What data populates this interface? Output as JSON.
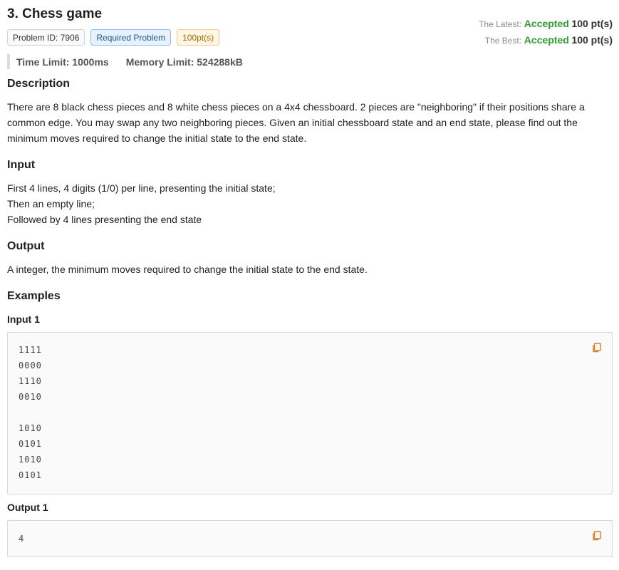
{
  "problem": {
    "title": "3.  Chess game",
    "id_tag": "Problem ID: 7906",
    "required_tag": "Required Problem",
    "points_tag": "100pt(s)"
  },
  "scores": {
    "latest_label": "The Latest:",
    "latest_status": "Accepted",
    "latest_points": "100 pt(s)",
    "best_label": "The Best:",
    "best_status": "Accepted",
    "best_points": "100 pt(s)"
  },
  "limits": {
    "time": "Time Limit: 1000ms",
    "memory": "Memory Limit: 524288kB"
  },
  "description": {
    "heading": "Description",
    "lines": [
      "There are 8 black chess pieces and 8 white chess pieces on a 4x4 chessboard. 2 pieces are \"neighboring\" if their positions share a",
      "common edge. You may swap any two neighboring pieces. Given an initial chessboard state and an end state, please find out the",
      "minimum moves required to change the initial state to the end state."
    ]
  },
  "input": {
    "heading": "Input",
    "lines": [
      "First 4 lines, 4 digits (1/0) per line, presenting the initial state;",
      "Then an empty line;",
      "Followed by 4 lines presenting the end state"
    ]
  },
  "output": {
    "heading": "Output",
    "lines": [
      "A integer, the minimum moves required to change the initial state to the end state."
    ]
  },
  "examples": {
    "heading": "Examples",
    "input_label": "Input 1",
    "input_lines": [
      "1111",
      "0000",
      "1110",
      "0010",
      "",
      "1010",
      "0101",
      "1010",
      "0101"
    ],
    "output_label": "Output 1",
    "output_lines": [
      "4"
    ]
  },
  "icons": {
    "copy": "copy-icon"
  },
  "colors": {
    "accepted": "#2ea12e",
    "copy_icon": "#e07a1f",
    "required_tag": "#1a56b0",
    "points_tag": "#b86a00"
  }
}
